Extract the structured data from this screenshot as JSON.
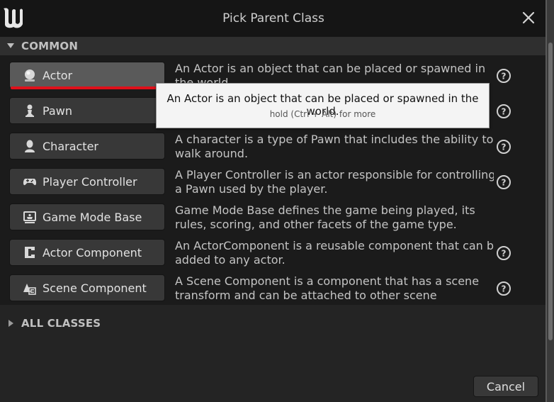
{
  "window": {
    "title": "Pick Parent Class",
    "logo_icon": "unreal-engine-logo",
    "close_icon": "close-icon"
  },
  "sections": {
    "common": {
      "label": "COMMON",
      "expanded": true
    },
    "all_classes": {
      "label": "ALL CLASSES",
      "expanded": false
    }
  },
  "classes": [
    {
      "label": "Actor",
      "icon": "actor-sphere-icon",
      "description": "An Actor is an object that can be placed or spawned in\nthe world.",
      "has_help": true
    },
    {
      "label": "Pawn",
      "icon": "pawn-icon",
      "description": "",
      "has_help": true
    },
    {
      "label": "Character",
      "icon": "character-icon",
      "description": "A character is a type of Pawn that includes the ability to\nwalk around.",
      "has_help": true
    },
    {
      "label": "Player Controller",
      "icon": "gamepad-icon",
      "description": "A Player Controller is an actor responsible for controlling\na Pawn used by the player.",
      "has_help": true
    },
    {
      "label": "Game Mode Base",
      "icon": "game-mode-icon",
      "description": "Game Mode Base defines the game being played, its\nrules, scoring, and other facets of the game type.",
      "has_help": false
    },
    {
      "label": "Actor Component",
      "icon": "actor-component-icon",
      "description": "An ActorComponent is a reusable component that can be\nadded to any actor.",
      "has_help": true
    },
    {
      "label": "Scene Component",
      "icon": "scene-component-icon",
      "description": "A Scene Component is a component that has a scene\ntransform and can be attached to other scene",
      "has_help": true
    }
  ],
  "tooltip": {
    "text": "An Actor is an object that can be placed or spawned in the world.",
    "hint": "hold (Ctrl + Alt) for more"
  },
  "footer": {
    "cancel_label": "Cancel"
  },
  "colors": {
    "accent_underline": "#e0101a",
    "panel_bg": "#242424",
    "button_bg": "#383838"
  }
}
